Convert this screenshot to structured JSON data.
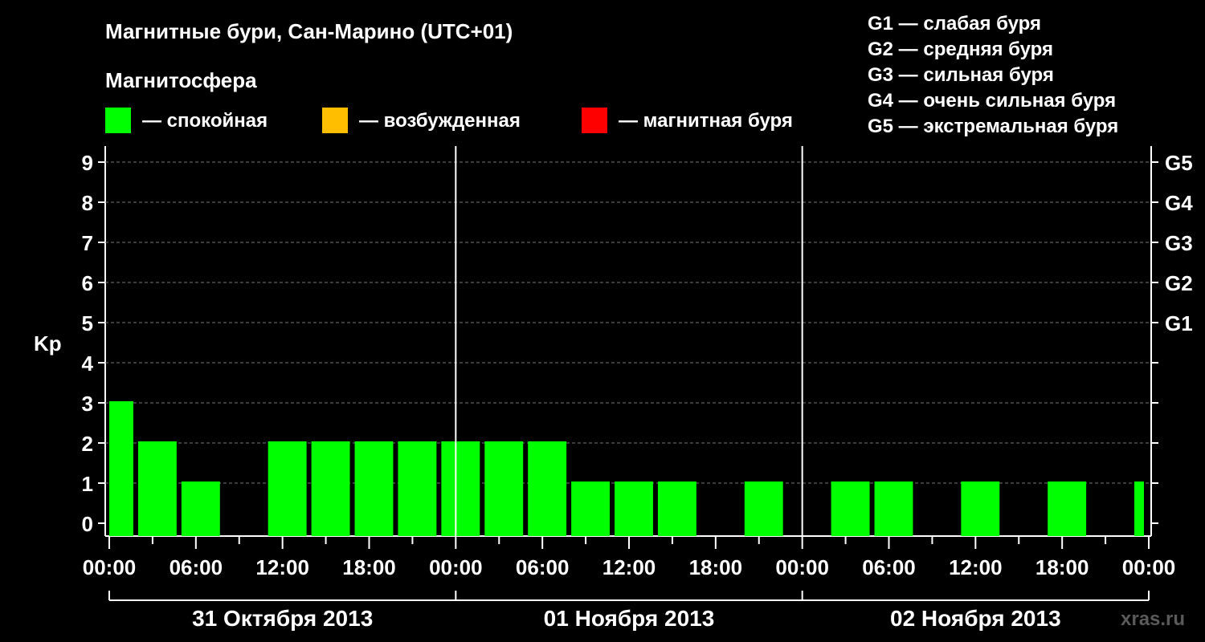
{
  "title": "Магнитные бури, Сан-Марино (UTC+01)",
  "legend": {
    "heading": "Магнитосфера",
    "items": [
      {
        "label": "— спокойная",
        "color": "#00ff00"
      },
      {
        "label": "— возбужденная",
        "color": "#ffbf00"
      },
      {
        "label": "— магнитная буря",
        "color": "#ff0000"
      }
    ],
    "storm_levels": [
      "G1 — слабая буря",
      "G2 — средняя буря",
      "G3 — сильная буря",
      "G4 — очень сильная буря",
      "G5 — экстремальная буря"
    ]
  },
  "watermark": "xras.ru",
  "chart_data": {
    "type": "bar",
    "ylabel": "Kp",
    "ylim": [
      0,
      9
    ],
    "y_ticks": [
      0,
      1,
      2,
      3,
      4,
      5,
      6,
      7,
      8,
      9
    ],
    "right_labels": [
      {
        "kp": 5,
        "label": "G1"
      },
      {
        "kp": 6,
        "label": "G2"
      },
      {
        "kp": 7,
        "label": "G3"
      },
      {
        "kp": 8,
        "label": "G4"
      },
      {
        "kp": 9,
        "label": "G5"
      }
    ],
    "x_tick_labels": [
      "00:00",
      "06:00",
      "12:00",
      "18:00",
      "00:00",
      "06:00",
      "12:00",
      "18:00",
      "00:00",
      "06:00",
      "12:00",
      "18:00",
      "00:00"
    ],
    "days": [
      "31 Октября 2013",
      "01 Ноября 2013",
      "02 Ноября 2013"
    ],
    "bar_color": "#00ff00",
    "bars": [
      {
        "start": "31.10 00:00",
        "end": "31.10 02:00",
        "kp": 3
      },
      {
        "start": "31.10 02:00",
        "end": "31.10 05:00",
        "kp": 2
      },
      {
        "start": "31.10 05:00",
        "end": "31.10 08:00",
        "kp": 1
      },
      {
        "start": "31.10 08:00",
        "end": "31.10 11:00",
        "kp": 0
      },
      {
        "start": "31.10 11:00",
        "end": "31.10 14:00",
        "kp": 2
      },
      {
        "start": "31.10 14:00",
        "end": "31.10 17:00",
        "kp": 2
      },
      {
        "start": "31.10 17:00",
        "end": "31.10 20:00",
        "kp": 2
      },
      {
        "start": "31.10 20:00",
        "end": "31.10 23:00",
        "kp": 2
      },
      {
        "start": "31.10 23:00",
        "end": "01.11 02:00",
        "kp": 2
      },
      {
        "start": "01.11 02:00",
        "end": "01.11 05:00",
        "kp": 2
      },
      {
        "start": "01.11 05:00",
        "end": "01.11 08:00",
        "kp": 2
      },
      {
        "start": "01.11 08:00",
        "end": "01.11 11:00",
        "kp": 1
      },
      {
        "start": "01.11 11:00",
        "end": "01.11 14:00",
        "kp": 1
      },
      {
        "start": "01.11 14:00",
        "end": "01.11 17:00",
        "kp": 1
      },
      {
        "start": "01.11 17:00",
        "end": "01.11 20:00",
        "kp": 0
      },
      {
        "start": "01.11 20:00",
        "end": "01.11 23:00",
        "kp": 1
      },
      {
        "start": "01.11 23:00",
        "end": "02.11 02:00",
        "kp": 0
      },
      {
        "start": "02.11 02:00",
        "end": "02.11 05:00",
        "kp": 1
      },
      {
        "start": "02.11 05:00",
        "end": "02.11 08:00",
        "kp": 1
      },
      {
        "start": "02.11 08:00",
        "end": "02.11 11:00",
        "kp": 0
      },
      {
        "start": "02.11 11:00",
        "end": "02.11 14:00",
        "kp": 1
      },
      {
        "start": "02.11 14:00",
        "end": "02.11 17:00",
        "kp": 0
      },
      {
        "start": "02.11 17:00",
        "end": "02.11 20:00",
        "kp": 1
      },
      {
        "start": "02.11 20:00",
        "end": "02.11 23:00",
        "kp": 0
      },
      {
        "start": "02.11 23:00",
        "end": "03.11 00:00",
        "kp": 1
      }
    ]
  }
}
